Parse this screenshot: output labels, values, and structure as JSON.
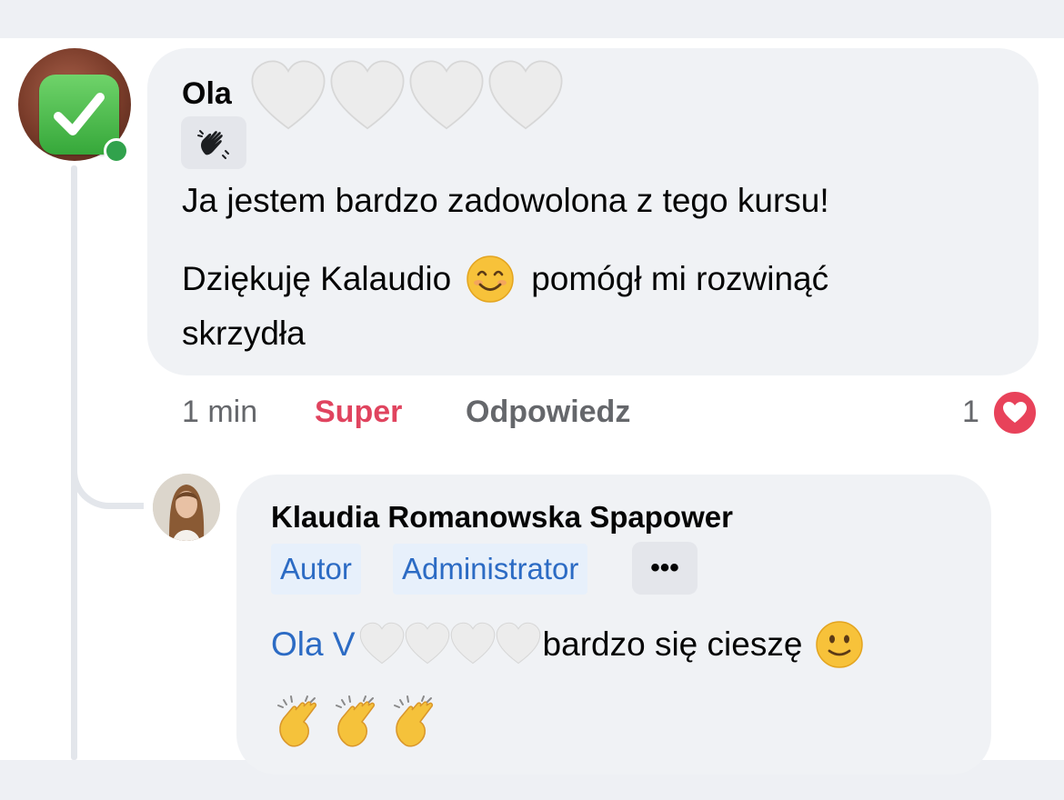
{
  "comment": {
    "author_visible": "Ola",
    "author_icon": "heart-icon",
    "badge_icon": "waving-hand-icon",
    "text_line1": "Ja jestem bardzo zadowolona z tego kursu!",
    "text_line2_a": "Dziękuję Kalaudio",
    "text_line2_emoji": "smiling-face-icon",
    "text_line2_b": "pomógł mi rozwinąć",
    "text_line3": "skrzydła",
    "time": "1 min",
    "reaction_label": "Super",
    "reply_label": "Odpowiedz",
    "reaction_count": "1"
  },
  "reply": {
    "author": "Klaudia Romanowska Spapower",
    "tags": [
      "Autor",
      "Administrator"
    ],
    "more_label": "•••",
    "mention_visible": "Ola V",
    "text": "bardzo się cieszę",
    "emoji": "slightly-smiling-face-icon",
    "claps_count": 3
  },
  "colors": {
    "bubble": "#f0f2f5",
    "love_red": "#e8425a",
    "super_red": "#e0445f",
    "link_blue": "#2c6bc4",
    "tag_bg": "#e7f0fb",
    "muted_gray": "#65676b"
  }
}
